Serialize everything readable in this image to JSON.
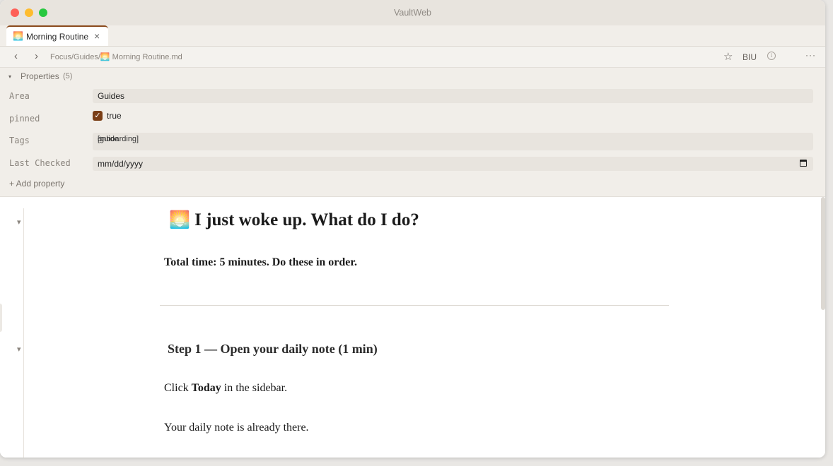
{
  "window": {
    "title": "VaultWeb"
  },
  "tab": {
    "emoji": "🌅",
    "label": "Morning Routine",
    "close": "×"
  },
  "nav": {
    "back": "‹",
    "forward": "›",
    "breadcrumb": "Focus/Guides/🌅 Morning Routine.md",
    "star": "☆",
    "format": "BIU",
    "info": "i",
    "more": "···"
  },
  "properties": {
    "toggle": "▾",
    "title": "Properties",
    "count": "(5)",
    "area": {
      "key": "Area",
      "value": "Guides"
    },
    "pinned": {
      "key": "pinned",
      "check": "✓",
      "value": "true"
    },
    "tags": {
      "key": "Tags",
      "items": [
        "[guide",
        "onboarding]"
      ],
      "remove": "×"
    },
    "last_checked": {
      "key": "Last Checked",
      "value": "mm/dd/yyyy"
    },
    "add": "+ Add property"
  },
  "doc": {
    "fold": "▾",
    "h1_emoji": "🌅",
    "h1": "I just woke up. What do I do?",
    "intro": "Total time: 5 minutes. Do these in order.",
    "step1": "Step 1 — Open your daily note (1 min)",
    "p1_pre": "Click ",
    "p1_bold": "Today",
    "p1_post": " in the sidebar.",
    "p2": "Your daily note is already there."
  },
  "colors": {
    "accent": "#7a3e16",
    "tab_border": "#8a4a1c"
  }
}
